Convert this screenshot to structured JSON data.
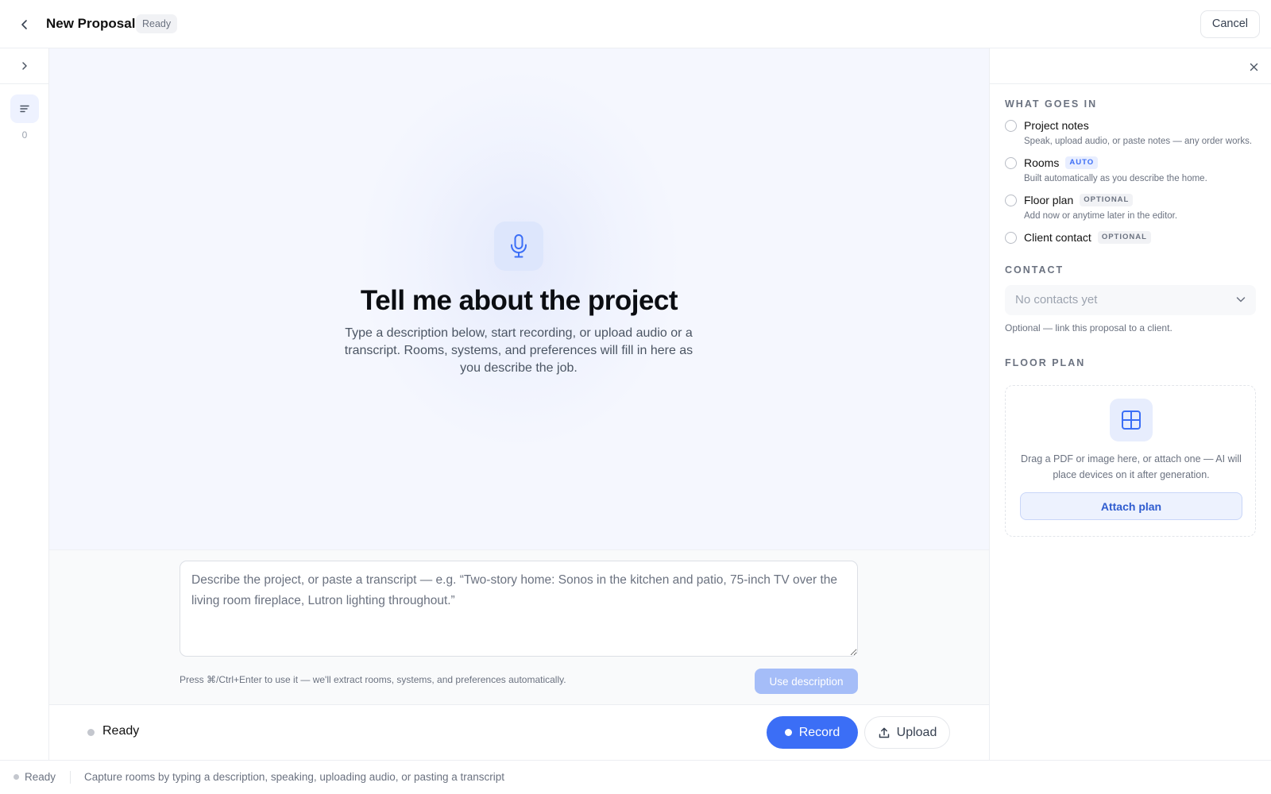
{
  "header": {
    "title": "New Proposal",
    "status": "Ready",
    "cancel_label": "Cancel"
  },
  "rail": {
    "notes_count": "0"
  },
  "hero": {
    "title": "Tell me about the project",
    "subtitle": "Type a description below, start recording, or upload audio or a transcript. Rooms, systems, and preferences will fill in here as you describe the job."
  },
  "composer": {
    "placeholder": "Describe the project, or paste a transcript — e.g. “Two-story home: Sonos in the kitchen and patio, 75-inch TV over the living room fireplace, Lutron lighting throughout.”",
    "value": "",
    "hint": "Press ⌘/Ctrl+Enter to use it — we'll extract rooms, systems, and preferences automatically.",
    "use_label": "Use description"
  },
  "action_bar": {
    "status": "Ready",
    "record_label": "Record",
    "upload_label": "Upload"
  },
  "panel": {
    "what_goes_in_label": "WHAT GOES IN",
    "items": [
      {
        "title": "Project notes",
        "tag": "",
        "desc": "Speak, upload audio, or paste notes — any order works.",
        "checked": false
      },
      {
        "title": "Rooms",
        "tag": "AUTO",
        "desc": "Built automatically as you describe the home.",
        "checked": false
      },
      {
        "title": "Floor plan",
        "tag": "OPTIONAL",
        "desc": "Add now or anytime later in the editor.",
        "checked": false
      },
      {
        "title": "Client contact",
        "tag": "OPTIONAL",
        "desc": "",
        "checked": false
      }
    ],
    "contact_label": "CONTACT",
    "contact_value": "No contacts yet",
    "contact_hint": "Optional — link this proposal to a client.",
    "floor_plan_label": "FLOOR PLAN",
    "floor_plan_text": "Drag a PDF or image here, or attach one — AI will place devices on it after generation.",
    "attach_label": "Attach plan"
  },
  "footer": {
    "status": "Ready",
    "message": "Capture rooms by typing a description, speaking, uploading audio, or pasting a transcript"
  },
  "colors": {
    "accent": "#3b6ef6",
    "hero_bg": "#f5f7fe",
    "muted_text": "#6b7280"
  },
  "icons": {
    "back": "chevron-left-icon",
    "expand": "chevron-right-icon",
    "notes": "notes-lines-icon",
    "mic": "microphone-icon",
    "close": "close-icon",
    "select": "chevron-down-icon",
    "floor_plan": "grid-icon",
    "upload": "upload-icon"
  }
}
